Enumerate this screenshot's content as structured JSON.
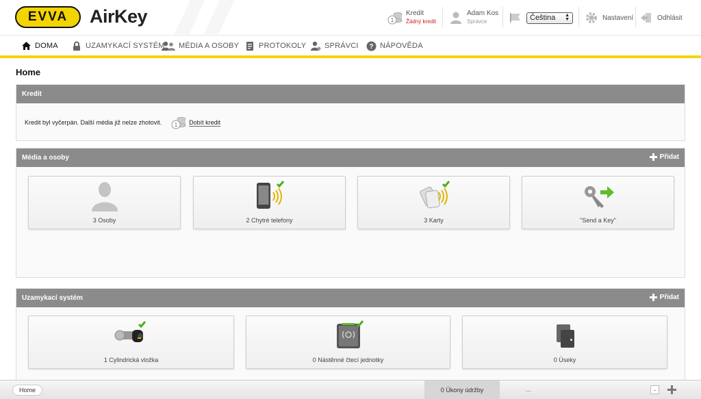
{
  "header": {
    "brand": "EVVA",
    "product": "AirKey",
    "credit": {
      "label": "Kredit",
      "status": "Žádný kredit"
    },
    "user": {
      "name": "Adam Kos",
      "role": "Správce"
    },
    "language": {
      "selected": "Čeština"
    },
    "settings_label": "Nastavení",
    "logout_label": "Odhlásit"
  },
  "nav": {
    "items": [
      {
        "label": "DOMA",
        "icon": "home-icon"
      },
      {
        "label": "UZAMYKACÍ SYSTÉM",
        "icon": "lock-icon"
      },
      {
        "label": "MÉDIA A OSOBY",
        "icon": "people-icon"
      },
      {
        "label": "PROTOKOLY",
        "icon": "document-icon"
      },
      {
        "label": "SPRÁVCI",
        "icon": "admin-icon"
      },
      {
        "label": "NÁPOVĚDA",
        "icon": "help-icon"
      }
    ]
  },
  "page": {
    "title": "Home"
  },
  "credit_panel": {
    "title": "Kredit",
    "message": "Kredit byl vyčerpán. Další média již nelze zhotovit.",
    "topup_label": "Dobít kredit"
  },
  "media_panel": {
    "title": "Média a osoby",
    "add_label": "Přidat",
    "tiles": [
      {
        "label": "3 Osoby",
        "icon": "person-icon"
      },
      {
        "label": "2 Chytré telefony",
        "icon": "smartphone-icon"
      },
      {
        "label": "3 Karty",
        "icon": "card-icon"
      },
      {
        "label": "\"Send a Key\"",
        "icon": "send-key-icon"
      }
    ]
  },
  "lock_panel": {
    "title": "Uzamykací systém",
    "add_label": "Přidat",
    "tiles": [
      {
        "label": "1 Cylindrická vložka",
        "icon": "cylinder-icon"
      },
      {
        "label": "0 Nástěnné čtecí jednotky",
        "icon": "wall-reader-icon"
      },
      {
        "label": "0 Úseky",
        "icon": "area-icon"
      }
    ]
  },
  "statusbar": {
    "crumb": "Home",
    "maintenance": "0 Úkony údržby",
    "dots": "...",
    "minus": "-"
  },
  "colors": {
    "brand_yellow": "#f4d400",
    "panel_header": "#8b8b8b",
    "check_green": "#4caf1a",
    "credit_warning": "#d0201f"
  }
}
